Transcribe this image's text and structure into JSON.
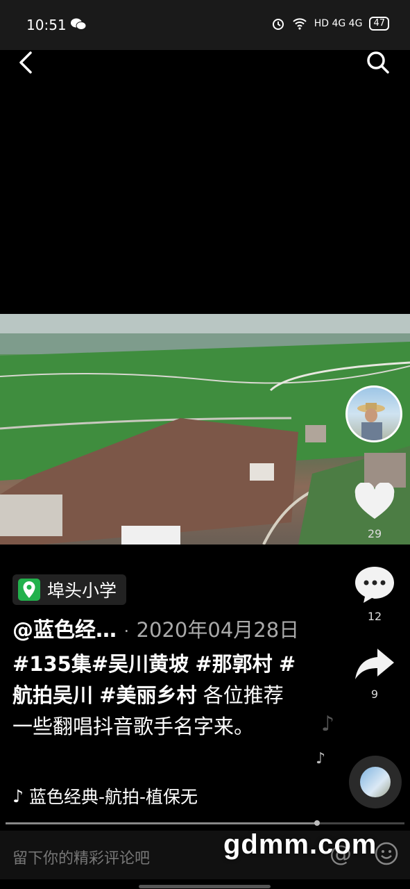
{
  "status": {
    "time": "10:51",
    "network": "HD 4G 4G",
    "battery": "47"
  },
  "video": {
    "likes": "29",
    "comments": "12",
    "shares": "9"
  },
  "location": {
    "label": "埠头小学"
  },
  "post": {
    "author": "@蓝色经…",
    "separator": "·",
    "date": "2020年04月28日",
    "tag1": "#135集#吴川黄坡",
    "tag2": "#那郭村",
    "tag3": "#航拍吴川",
    "tag4": "#美丽乡村",
    "text": "各位推荐一些翻唱抖音歌手名字来。"
  },
  "music": {
    "note": "♪",
    "title": "蓝色经典-航拍-植保无"
  },
  "comment": {
    "placeholder": "留下你的精彩评论吧",
    "at": "@"
  },
  "watermark": "gdmm.com",
  "progress": 0.78
}
